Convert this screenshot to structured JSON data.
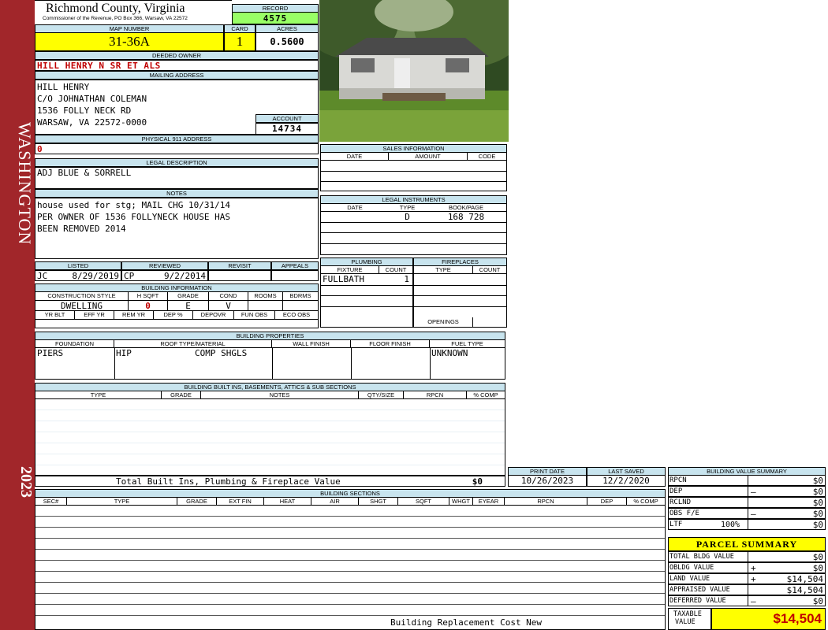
{
  "sidebar": {
    "district": "WASHINGTON",
    "year": "2023"
  },
  "header": {
    "county": "Richmond County, Virginia",
    "address": "Commissioner of the Revenue, PO Box 366, Warsaw, VA 22572",
    "record_label": "RECORD",
    "record": "4575",
    "map_label": "MAP NUMBER",
    "map_number": "31-36A",
    "card_label": "CARD",
    "card": "1",
    "acres_label": "ACRES",
    "acres": "0.5600"
  },
  "owner": {
    "deeded_label": "DEEDED OWNER",
    "deeded": "HILL HENRY N SR ET ALS",
    "mailing_label": "MAILING ADDRESS",
    "mailing": [
      "HILL HENRY",
      "C/O JOHNATHAN COLEMAN",
      "1536 FOLLY NECK RD",
      "WARSAW, VA 22572-0000"
    ],
    "account_label": "ACCOUNT",
    "account": "14734"
  },
  "physical": {
    "label": "PHYSICAL 911 ADDRESS",
    "value": "0"
  },
  "legal": {
    "label": "LEGAL DESCRIPTION",
    "value": "ADJ BLUE & SORRELL"
  },
  "notes": {
    "label": "NOTES",
    "lines": [
      "house used for stg; MAIL CHG 10/31/14",
      "PER OWNER OF 1536 FOLLYNECK HOUSE HAS",
      "BEEN REMOVED 2014"
    ]
  },
  "sales": {
    "label": "SALES INFORMATION",
    "cols": [
      "DATE",
      "AMOUNT",
      "CODE"
    ]
  },
  "instruments": {
    "label": "LEGAL INSTRUMENTS",
    "cols": [
      "DATE",
      "TYPE",
      "BOOK/PAGE"
    ],
    "type": "D",
    "bookpage": "168 728"
  },
  "listed": {
    "labels": [
      "LISTED",
      "REVIEWED",
      "REVISIT",
      "APPEALS"
    ],
    "lister": "JC",
    "listed": "8/29/2019",
    "reviewer": "CP",
    "reviewed": "9/2/2014"
  },
  "plumbing": {
    "label": "PLUMBING",
    "cols": [
      "FIXTURE",
      "COUNT"
    ],
    "fixture": "FULLBATH",
    "count": "1"
  },
  "fireplaces": {
    "label": "FIREPLACES",
    "cols": [
      "TYPE",
      "COUNT"
    ],
    "openings": "OPENINGS"
  },
  "building_info": {
    "label": "BUILDING INFORMATION",
    "cols": [
      "CONSTRUCTION STYLE",
      "H SQFT",
      "GRADE",
      "COND",
      "ROOMS",
      "BDRMS"
    ],
    "style": "DWELLING",
    "hsqft": "0",
    "grade": "E",
    "cond": "V",
    "cols2": [
      "YR BLT",
      "EFF YR",
      "REM YR",
      "DEP %",
      "DEPOVR",
      "FUN OBS",
      "ECO OBS"
    ]
  },
  "properties": {
    "label": "BUILDING PROPERTIES",
    "cols": [
      "FOUNDATION",
      "ROOF TYPE/MATERIAL",
      "WALL FINISH",
      "FLOOR FINISH",
      "FUEL TYPE"
    ],
    "foundation": "PIERS",
    "roof_type": "HIP",
    "roof_mat": "COMP SHGLS",
    "fuel": "UNKNOWN"
  },
  "builtins": {
    "label": "BUILDING BUILT INS, BASEMENTS, ATTICS & SUB SECTIONS",
    "cols": [
      "TYPE",
      "GRADE",
      "NOTES",
      "QTY/SIZE",
      "RPCN",
      "% COMP"
    ],
    "total_label": "Total Built Ins, Plumbing & Fireplace Value",
    "total": "$0"
  },
  "dates": {
    "print_label": "PRINT DATE",
    "print": "10/26/2023",
    "saved_label": "LAST SAVED",
    "saved": "12/2/2020"
  },
  "sections": {
    "label": "BUILDING SECTIONS",
    "cols": [
      "SEC#",
      "TYPE",
      "GRADE",
      "EXT FIN",
      "HEAT",
      "AIR",
      "SHGT",
      "SQFT",
      "WHGT",
      "EYEAR",
      "RPCN",
      "DEP",
      "% COMP"
    ],
    "footer": "Building Replacement Cost New"
  },
  "bvs": {
    "label": "BUILDING VALUE SUMMARY",
    "rows": [
      {
        "name": "RPCN",
        "sign": "",
        "value": "$0"
      },
      {
        "name": "DEP",
        "sign": "–",
        "value": "$0"
      },
      {
        "name": "RCLND",
        "sign": "",
        "value": "$0"
      },
      {
        "name": "OBS F/E",
        "sign": "–",
        "value": "$0"
      },
      {
        "name": "LTF",
        "pct": "100%",
        "sign": "",
        "value": "$0"
      }
    ]
  },
  "parcel": {
    "label": "PARCEL SUMMARY",
    "rows": [
      {
        "name": "TOTAL BLDG VALUE",
        "sign": "",
        "value": "$0"
      },
      {
        "name": "OBLDG VALUE",
        "sign": "+",
        "value": "$0"
      },
      {
        "name": "LAND VALUE",
        "sign": "+",
        "value": "$14,504"
      },
      {
        "name": "APPRAISED VALUE",
        "sign": "",
        "value": "$14,504"
      },
      {
        "name": "DEFERRED VALUE",
        "sign": "–",
        "value": "$0"
      }
    ],
    "taxable_label1": "TAXABLE",
    "taxable_label2": "VALUE",
    "taxable": "$14,504"
  },
  "colors": {
    "sidebar": "#a1262a",
    "header_band": "#c8e4ee",
    "highlight": "#ffff00",
    "record": "#99ff66",
    "accent_red": "#c00000"
  }
}
